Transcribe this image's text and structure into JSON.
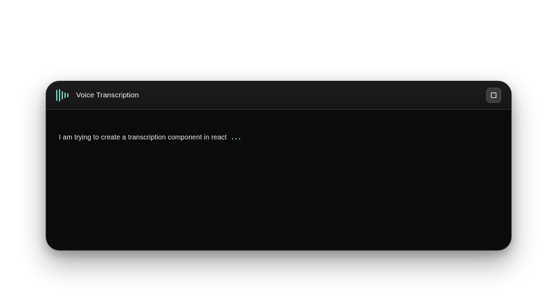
{
  "app": {
    "title": "Voice Transcription"
  },
  "transcript": {
    "text": "I am trying to create a transcription component in react"
  },
  "icons": {
    "logo": "audio-waveform-icon",
    "stop": "stop-icon",
    "typing": "typing-dots-icon"
  },
  "colors": {
    "card_background": "#0b0b0b",
    "header_background": "#1a1a1a",
    "accent": "#6fc7b7",
    "button_background": "#3b3b3b",
    "text": "#eaeaea"
  }
}
